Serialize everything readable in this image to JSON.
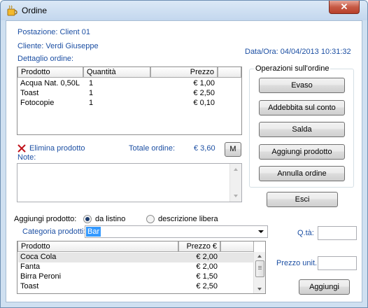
{
  "window": {
    "title": "Ordine",
    "close_symbol": "✕"
  },
  "header": {
    "postazione": "Postazione: Client 01",
    "cliente": "Cliente: Verdi Giuseppe",
    "dettaglio": "Dettaglio ordine:",
    "dataora": "Data/Ora: 04/04/2013 10:31:32"
  },
  "order_grid": {
    "columns": [
      "Prodotto",
      "Quantità",
      "Prezzo"
    ],
    "rows": [
      {
        "prodotto": "Acqua Nat. 0,50L",
        "quantita": "1",
        "prezzo": "€ 1,00"
      },
      {
        "prodotto": "Toast",
        "quantita": "1",
        "prezzo": "€ 2,50"
      },
      {
        "prodotto": "Fotocopie",
        "quantita": "1",
        "prezzo": "€ 0,10"
      }
    ]
  },
  "order_actions": {
    "elimina_label": "Elimina prodotto",
    "totale_label": "Totale ordine:",
    "totale_value": "€ 3,60",
    "m_button": "M",
    "note_label": "Note:"
  },
  "operazioni": {
    "title": "Operazioni sull'ordine",
    "evaso": "Evaso",
    "addebbita": "Addebbita sul conto",
    "salda": "Salda",
    "aggiungi": "Aggiungi prodotto",
    "annulla": "Annulla ordine"
  },
  "esci_label": "Esci",
  "add_product": {
    "label": "Aggiungi prodotto:",
    "radio_listino": "da listino",
    "radio_libera": "descrizione libera",
    "categoria_label": "Categoria prodotti:",
    "categoria_value": "Bar"
  },
  "product_list": {
    "columns": [
      "Prodotto",
      "Prezzo €"
    ],
    "rows": [
      {
        "prodotto": "Coca Cola",
        "prezzo": "€ 2,00"
      },
      {
        "prodotto": "Fanta",
        "prezzo": "€ 2,00"
      },
      {
        "prodotto": "Birra Peroni",
        "prezzo": "€ 1,50"
      },
      {
        "prodotto": "Toast",
        "prezzo": "€ 2,50"
      }
    ]
  },
  "right_inputs": {
    "qta_label": "Q.tà:",
    "prezzo_label": "Prezzo unit.:",
    "aggiungi_button": "Aggiungi"
  }
}
